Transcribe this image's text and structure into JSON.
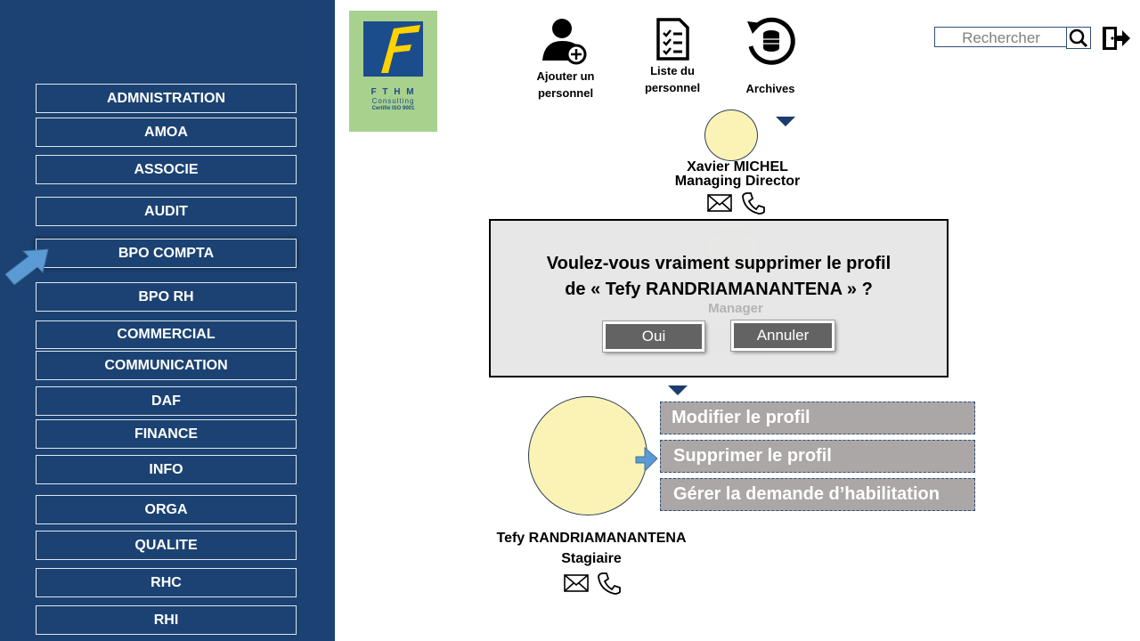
{
  "sidebar": {
    "items": [
      {
        "label": "ADMNISTRATION"
      },
      {
        "label": "AMOA"
      },
      {
        "label": "ASSOCIE"
      },
      {
        "label": "AUDIT"
      },
      {
        "label": "BPO COMPTA"
      },
      {
        "label": "BPO RH"
      },
      {
        "label": "COMMERCIAL"
      },
      {
        "label": "COMMUNICATION"
      },
      {
        "label": "DAF"
      },
      {
        "label": "FINANCE"
      },
      {
        "label": "INFO"
      },
      {
        "label": "ORGA"
      },
      {
        "label": "QUALITE"
      },
      {
        "label": "RHC"
      },
      {
        "label": "RHI"
      }
    ]
  },
  "logo": {
    "letter": "F",
    "brand": "F T H M",
    "sub": "Consulting",
    "cert": "Certifié ISO 9001"
  },
  "toolbar": {
    "add_line1": "Ajouter un",
    "add_line2": "personnel",
    "list_line1": "Liste du",
    "list_line2": "personnel",
    "archives": "Archives"
  },
  "search": {
    "placeholder": "Rechercher"
  },
  "org": {
    "top": {
      "name": "Xavier MICHEL",
      "role": "Managing Director"
    },
    "middle": {
      "role": "Manager"
    },
    "bottom": {
      "name": "Tefy RANDRIAMANANTENA",
      "role": "Stagiaire"
    }
  },
  "modal": {
    "line1": "Voulez-vous vraiment supprimer le profil",
    "line2": "de « Tefy RANDRIAMANANTENA » ?",
    "ok": "Oui",
    "cancel": "Annuler"
  },
  "context_menu": {
    "items": [
      {
        "label": "Modifier le profil"
      },
      {
        "label": "Supprimer le profil"
      },
      {
        "label": "Gérer la demande d’habilitation"
      }
    ]
  },
  "colors": {
    "sidebar": "#1b4272",
    "logo_bg": "#a9d18e",
    "avatar": "#fbf3b5",
    "menu_bg": "#aba7a6",
    "arrow": "#5b9bd5"
  }
}
